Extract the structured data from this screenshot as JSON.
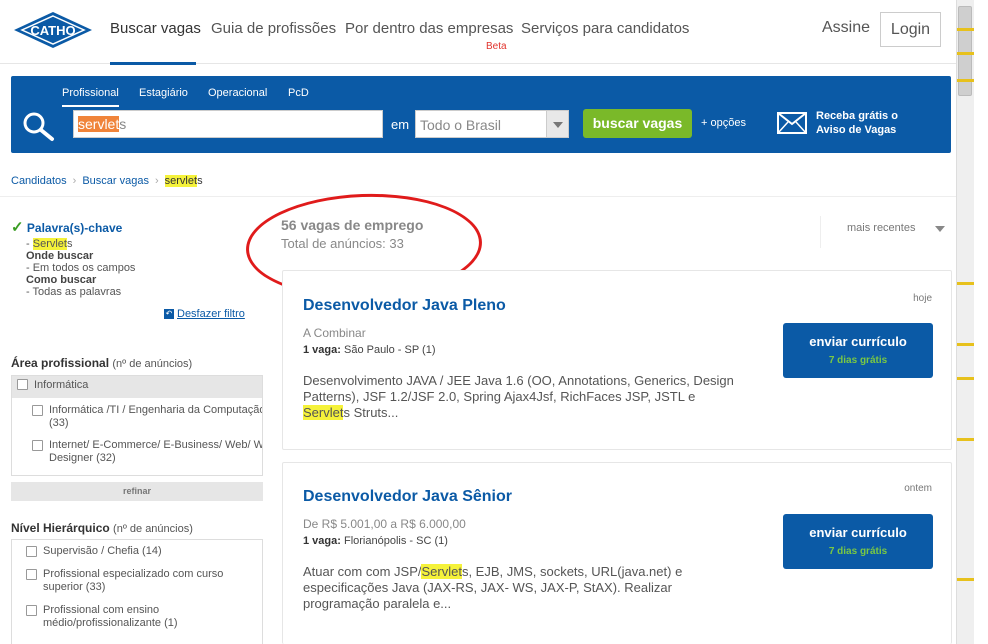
{
  "nav": {
    "logo_text": "CATHO",
    "items": [
      "Buscar vagas",
      "Guia de profissões",
      "Por dentro das empresas",
      "Serviços para candidatos"
    ],
    "beta": "Beta",
    "assine": "Assine",
    "login": "Login"
  },
  "search": {
    "tabs": [
      "Profissional",
      "Estagiário",
      "Operacional",
      "PcD"
    ],
    "keyword_highlight": "servlet",
    "keyword_rest": "s",
    "em_label": "em",
    "location": "Todo o Brasil",
    "button": "buscar vagas",
    "more_options": "+ opções",
    "alert_line1": "Receba grátis o",
    "alert_line2": "Aviso de Vagas"
  },
  "breadcrumb": {
    "items": [
      "Candidatos",
      "Buscar vagas"
    ],
    "current_highlight": "servlet",
    "current_rest": "s"
  },
  "sidebar": {
    "keyword_title": "Palavra(s)-chave",
    "keyword_prefix": "- ",
    "keyword_highlight": "Servlet",
    "keyword_rest": "s",
    "onde_buscar": "Onde buscar",
    "onde_value": "- Em todos os campos",
    "como_buscar": "Como buscar",
    "como_value": "- Todas as palavras",
    "desfazer": "Desfazer filtro",
    "area": {
      "title": "Área profissional",
      "hint": "(nº de anúncios)",
      "group": "Informática",
      "options": [
        {
          "line1": "Informática /TI / Engenharia da Computação",
          "line2": "(33)"
        },
        {
          "line1": "Internet/ E-Commerce/ E-Business/ Web/ Web",
          "line2": "Designer (32)"
        }
      ],
      "refinar": "refinar"
    },
    "nivel": {
      "title": "Nível Hierárquico",
      "hint": "(nº de anúncios)",
      "options": [
        {
          "line1": "Supervisão / Chefia (14)",
          "line2": ""
        },
        {
          "line1": "Profissional especializado com curso",
          "line2": "superior (33)"
        },
        {
          "line1": "Profissional com ensino",
          "line2": "médio/profissionalizante (1)"
        }
      ]
    }
  },
  "results": {
    "count": "56 vagas de emprego",
    "total": "Total de anúncios: 33",
    "sort": "mais recentes",
    "jobs": [
      {
        "when": "hoje",
        "title": "Desenvolvedor Java Pleno",
        "salary": "A Combinar",
        "vagas_label": "1 vaga:",
        "location": "São Paulo - SP (1)",
        "desc_before": "Desenvolvimento JAVA / JEE Java 1.6 (OO, Annotations, Generics, Design Patterns), JSF 1.2/JSF 2.0, Spring Ajax4Jsf, RichFaces JSP, JSTL e ",
        "desc_highlight": "Servlet",
        "desc_after": "s Struts...",
        "apply": "enviar currículo",
        "free": "7 dias grátis"
      },
      {
        "when": "ontem",
        "title": "Desenvolvedor Java Sênior",
        "salary": "De R$ 5.001,00 a R$ 6.000,00",
        "vagas_label": "1 vaga:",
        "location": "Florianópolis - SC (1)",
        "desc_before": "Atuar com com JSP/",
        "desc_highlight": "Servlet",
        "desc_after": "s, EJB, JMS, sockets, URL(java.net) e especificações Java (JAX-RS, JAX- WS, JAX-P, StAX). Realizar programação paralela e...",
        "apply": "enviar currículo",
        "free": "7 dias grátis"
      }
    ]
  },
  "colors": {
    "brand_blue": "#0b5aa6",
    "search_green": "#7ab929",
    "highlight_yellow": "#f5f23a",
    "annotation_red": "#e01b1b"
  }
}
